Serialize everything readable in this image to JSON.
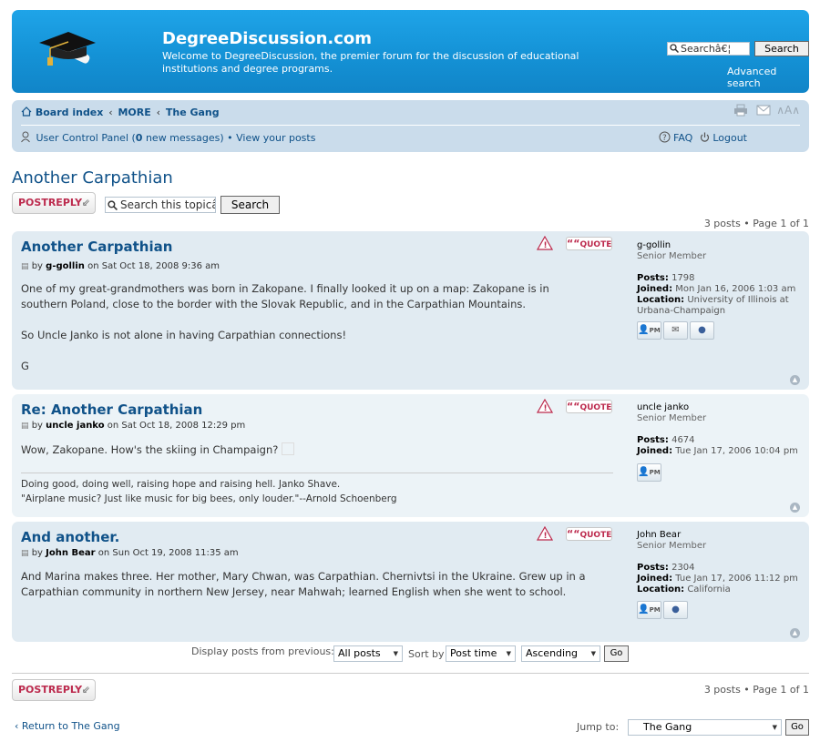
{
  "header": {
    "site_title": "DegreeDiscussion.com",
    "site_desc": "Welcome to DegreeDiscussion, the premier forum for the discussion of educational institutions and degree programs.",
    "search_placeholder": "Searchâ€¦",
    "search_button": "Search",
    "advanced_search": "Advanced search"
  },
  "nav": {
    "crumbs": [
      "Board index",
      "MORE",
      "The Gang"
    ],
    "ucp_label": "User Control Panel (",
    "ucp_count": "0",
    "ucp_suffix": " new messages)",
    "view_posts": "View your posts",
    "faq": "FAQ",
    "logout": "Logout",
    "font_size": "∧A∧"
  },
  "topic": {
    "title": "Another Carpathian",
    "post_reply": "POSTREPLY",
    "search_placeholder": "Search this topic…",
    "search_placeholder_display": "Search this topicâ€¦",
    "search_button": "Search",
    "pagination": "3 posts • Page 1 of 1"
  },
  "posts": [
    {
      "title": "Another Carpathian",
      "by": "by",
      "author": "g-gollin",
      "date": "on Sat Oct 18, 2008 9:36 am",
      "body": [
        "One of my great-grandmothers was born in Zakopane. I finally looked it up on a map: Zakopane is in southern Poland, close to the border with the Slovak Republic, and in the Carpathian Mountains.",
        "So Uncle Janko is not alone in having Carpathian connections!",
        "G"
      ],
      "profile": {
        "username": "g-gollin",
        "rank": "Senior Member",
        "posts_label": "Posts:",
        "posts": "1798",
        "joined_label": "Joined:",
        "joined": "Mon Jan 16, 2006 1:03 am",
        "location_label": "Location:",
        "location": "University of Illinois at Urbana-Champaign"
      },
      "quote": "QUOTE"
    },
    {
      "title": "Re: Another Carpathian",
      "by": "by",
      "author": "uncle janko",
      "date": "on Sat Oct 18, 2008 12:29 pm",
      "body": [
        "Wow, Zakopane. How's the skiing in Champaign?"
      ],
      "signature": [
        "Doing good, doing well, raising hope and raising hell. Janko Shave.",
        "\"Airplane music? Just like music for big bees, only louder.\"--Arnold Schoenberg"
      ],
      "profile": {
        "username": "uncle janko",
        "rank": "Senior Member",
        "posts_label": "Posts:",
        "posts": "4674",
        "joined_label": "Joined:",
        "joined": "Tue Jan 17, 2006 10:04 pm"
      },
      "quote": "QUOTE"
    },
    {
      "title": "And another.",
      "by": "by",
      "author": "John Bear",
      "date": "on Sun Oct 19, 2008 11:35 am",
      "body": [
        "And Marina makes three. Her mother, Mary Chwan, was Carpathian. Chernivtsi in the Ukraine. Grew up in a Carpathian community in northern New Jersey, near Mahwah; learned English when she went to school."
      ],
      "profile": {
        "username": "John Bear",
        "rank": "Senior Member",
        "posts_label": "Posts:",
        "posts": "2304",
        "joined_label": "Joined:",
        "joined": "Tue Jan 17, 2006 11:12 pm",
        "location_label": "Location:",
        "location": "California"
      },
      "quote": "QUOTE"
    }
  ],
  "display_bar": {
    "display_label": "Display posts from previous:",
    "display_value": "All posts",
    "sort_label": "Sort by",
    "sort_value": "Post time",
    "order_value": "Ascending",
    "go": "Go"
  },
  "footer": {
    "return_link": "Return to The Gang",
    "jump_label": "Jump to:",
    "jump_value": "The Gang",
    "go": "Go",
    "pagination": "3 posts • Page 1 of 1"
  },
  "icons": {
    "pm": "PM",
    "quote_mark": "““"
  },
  "colors": {
    "header_blue": "#1492d6",
    "nav_bg": "#cadceb",
    "post_bg_2": "#e1ebf2",
    "post_bg_1": "#ecf3f7",
    "link": "#105289",
    "reply_red": "#bc2a4d"
  }
}
